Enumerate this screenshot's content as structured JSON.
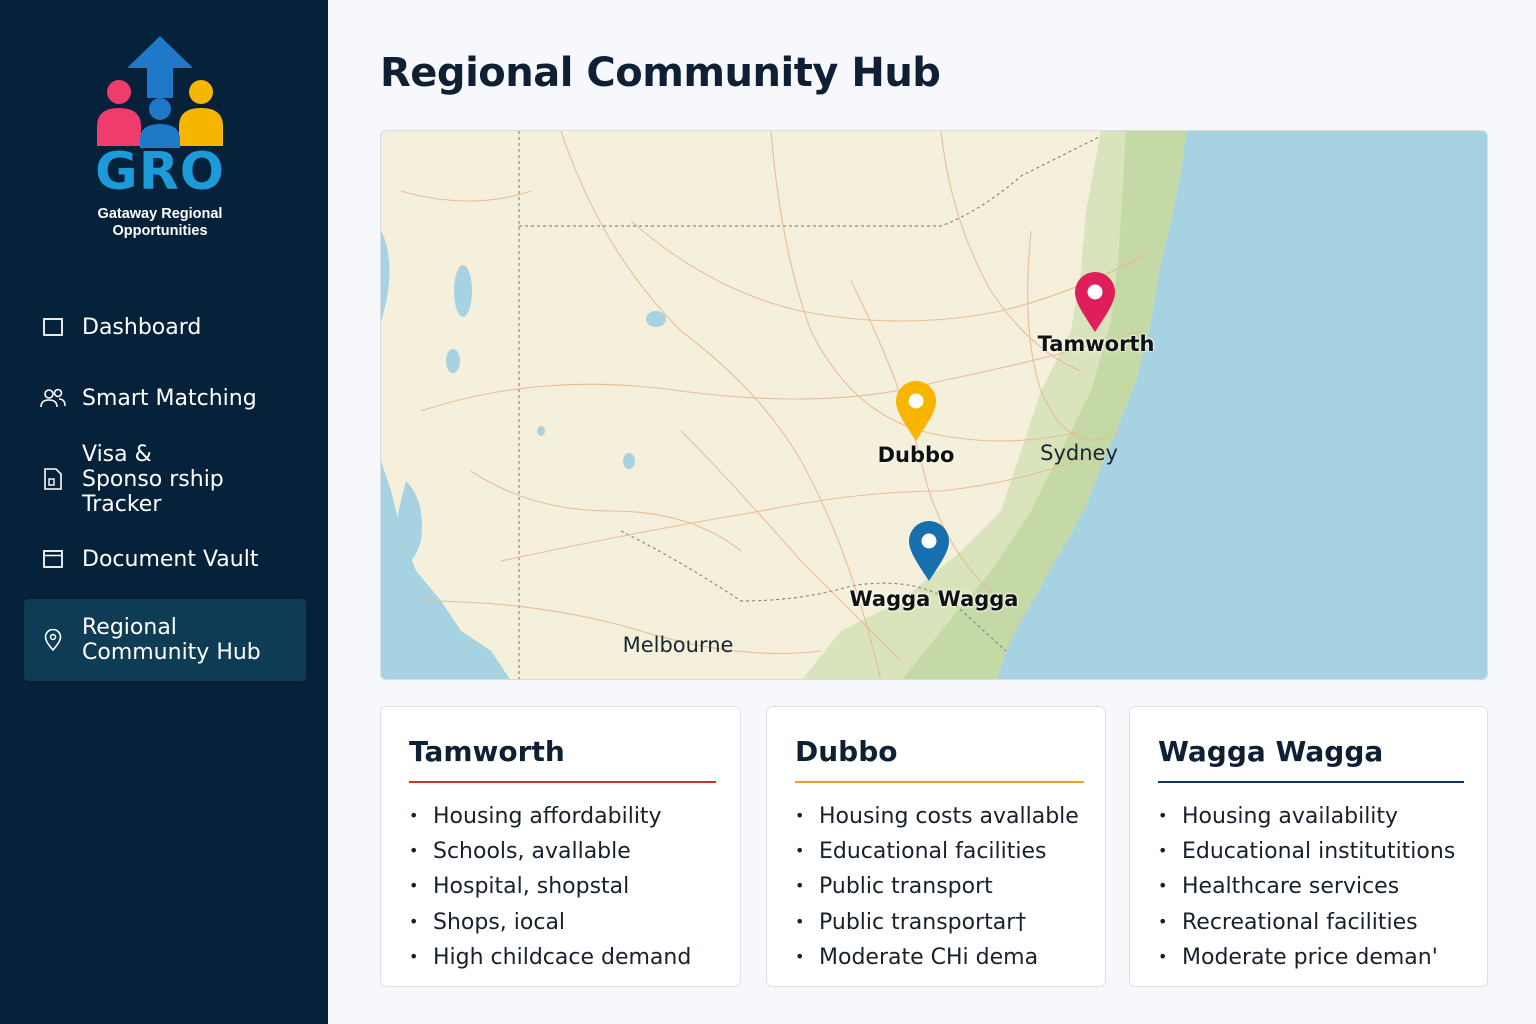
{
  "app": {
    "logo_text": "GRO",
    "logo_subtitle": "Gataway Regional Opportunities"
  },
  "sidebar": {
    "items": [
      {
        "label": "Dashboard",
        "icon": "square-icon",
        "active": false
      },
      {
        "label": "Smart Matching",
        "icon": "users-icon",
        "active": false
      },
      {
        "label": "Visa &\nSponso rship Tracker",
        "icon": "document-icon",
        "active": false
      },
      {
        "label": "Document Vault",
        "icon": "vault-icon",
        "active": false
      },
      {
        "label": "Regional\nCommunity Hub",
        "icon": "map-pin-icon",
        "active": true
      }
    ]
  },
  "main": {
    "title": "Regional Community Hub"
  },
  "map": {
    "markers": [
      {
        "label": "Tamworth",
        "color": "#e01e5a"
      },
      {
        "label": "Dubbo",
        "color": "#f7b500"
      },
      {
        "label": "Wagga Wagga",
        "color": "#1570ad"
      }
    ],
    "places": [
      "Sydney",
      "Melbourne"
    ]
  },
  "cards": [
    {
      "title": "Tamworth",
      "accent": "#d32f2f",
      "items": [
        "Housing affordability",
        "Schools, avallable",
        "Hospital, shopstal",
        "Shops, iocal",
        "High childcace demand"
      ]
    },
    {
      "title": "Dubbo",
      "accent": "#f0a020",
      "items": [
        "Housing costs avallable",
        "Educational facilities",
        "Public transport",
        "Public transportar†",
        "Moderate CHi dema"
      ]
    },
    {
      "title": "Wagga Wagga",
      "accent": "#12345e",
      "items": [
        "Housing availability",
        "Educational institutitions",
        "Healthcare services",
        "Recreational facilities",
        "Moderate price deman'"
      ]
    }
  ],
  "colors": {
    "sidebar_bg": "#06213a",
    "sidebar_active": "#0e3c55",
    "ocean": "#a6d2e1",
    "land": "#f4f0dc"
  }
}
